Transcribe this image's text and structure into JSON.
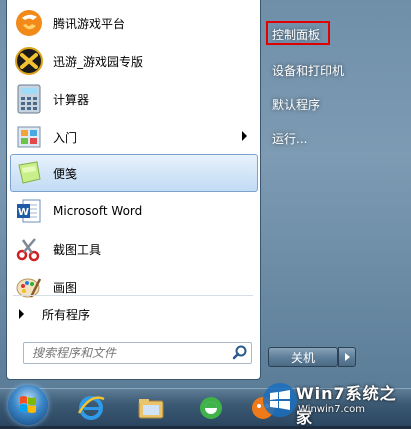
{
  "left_items": [
    {
      "label": "腾讯游戏平台",
      "icon": "tencent-games-icon"
    },
    {
      "label": "迅游_游戏园专版",
      "icon": "xunyou-icon"
    },
    {
      "label": "计算器",
      "icon": "calculator-icon"
    },
    {
      "label": "入门",
      "icon": "getting-started-icon"
    },
    {
      "label": "便笺",
      "icon": "sticky-notes-icon"
    },
    {
      "label": "Microsoft Word",
      "icon": "word-icon"
    },
    {
      "label": "截图工具",
      "icon": "snipping-tool-icon"
    },
    {
      "label": "画图",
      "icon": "paint-icon"
    }
  ],
  "all_programs": "所有程序",
  "search": {
    "placeholder": "搜索程序和文件"
  },
  "right_items": {
    "control_panel": "控制面板",
    "devices_printers": "设备和打印机",
    "default_programs": "默认程序",
    "run": "运行..."
  },
  "shutdown_label": "关机",
  "watermark": {
    "line1": "Win7系统之家",
    "line2": "Winwin7.com"
  },
  "colors": {
    "highlight_box": "#e00000",
    "selected_bg": "#d4e6f8"
  }
}
